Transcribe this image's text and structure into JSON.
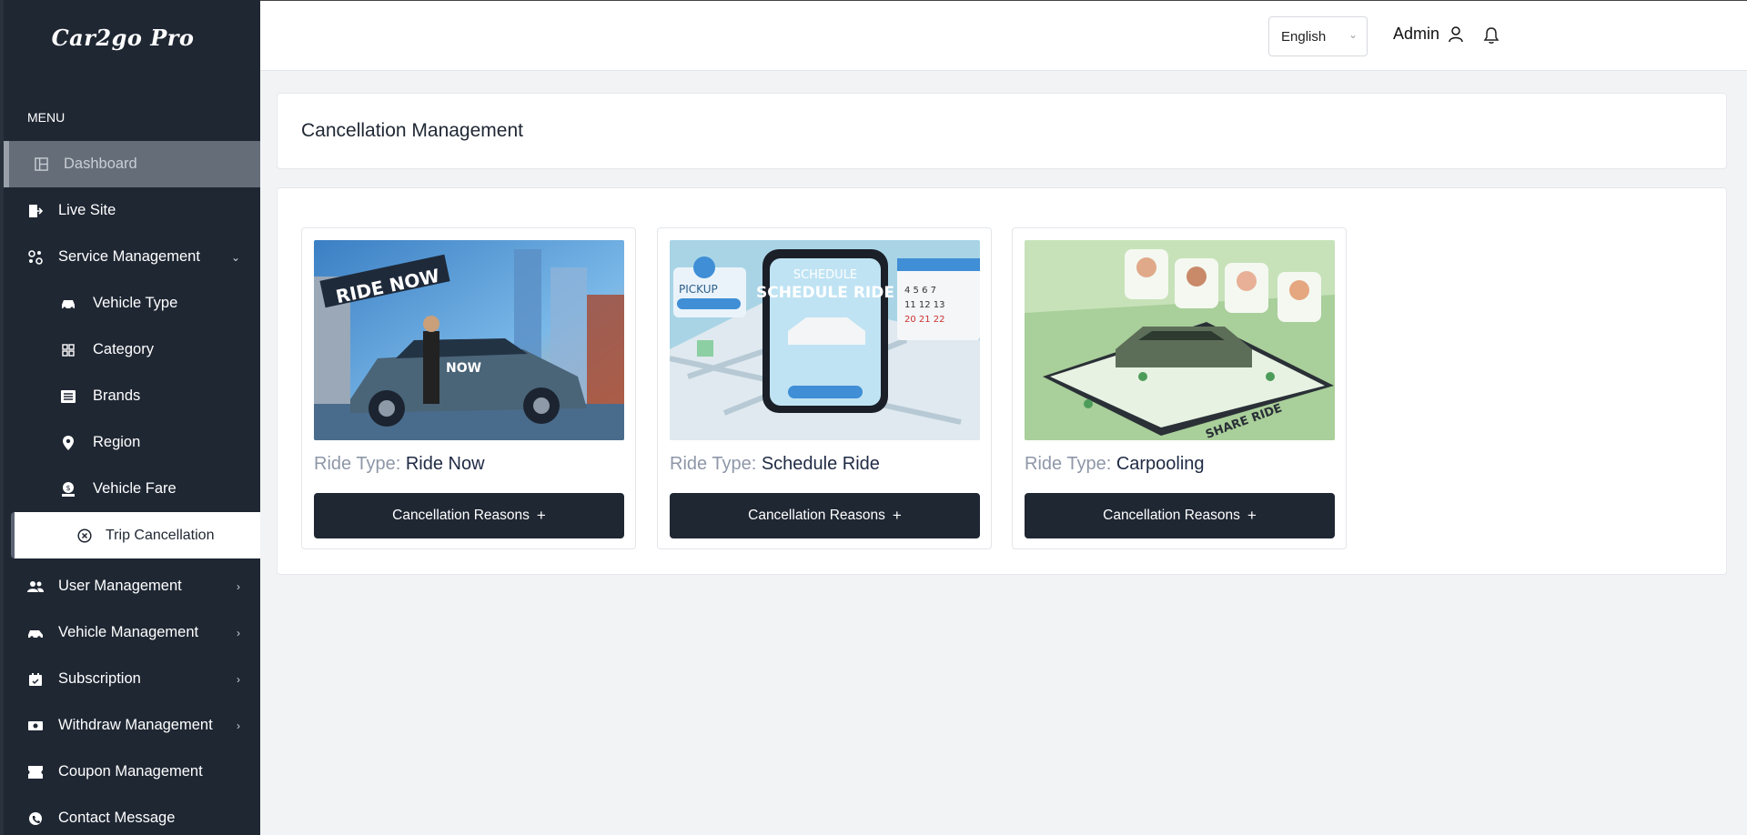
{
  "app": {
    "logo_text": "Car2go Pro"
  },
  "sidebar": {
    "menu_heading": "MENU",
    "items": [
      {
        "label": "Dashboard",
        "icon": "dashboard-icon"
      },
      {
        "label": "Live Site",
        "icon": "live-site-icon"
      },
      {
        "label": "Service Management",
        "icon": "service-icon"
      },
      {
        "label": "Vehicle Type",
        "icon": "car-icon"
      },
      {
        "label": "Category",
        "icon": "category-icon"
      },
      {
        "label": "Brands",
        "icon": "brands-icon"
      },
      {
        "label": "Region",
        "icon": "location-pin-icon"
      },
      {
        "label": "Vehicle Fare",
        "icon": "fare-icon"
      },
      {
        "label": "Trip Cancellation",
        "icon": "cancel-circle-icon"
      },
      {
        "label": "User Management",
        "icon": "users-icon"
      },
      {
        "label": "Vehicle Management",
        "icon": "vehicle-icon"
      },
      {
        "label": "Subscription",
        "icon": "subscription-icon"
      },
      {
        "label": "Withdraw Management",
        "icon": "withdraw-icon"
      },
      {
        "label": "Coupon Management",
        "icon": "coupon-icon"
      },
      {
        "label": "Contact Message",
        "icon": "contact-icon"
      }
    ]
  },
  "header": {
    "language": "English",
    "user": "Admin"
  },
  "page": {
    "title": "Cancellation Management",
    "ride_type_label": "Ride Type:",
    "cards": [
      {
        "ride_type": "Ride Now",
        "image_caption": "RIDE NOW",
        "button": "Cancellation Reasons"
      },
      {
        "ride_type": "Schedule Ride",
        "image_caption": "SCHEDULE RIDE",
        "button": "Cancellation Reasons"
      },
      {
        "ride_type": "Carpooling",
        "image_caption": "SHARE RIDE",
        "button": "Cancellation Reasons"
      }
    ]
  },
  "colors": {
    "sidebar_bg": "#1f2733",
    "accent_dark": "#1f2733",
    "muted_label": "#8e97a8"
  }
}
